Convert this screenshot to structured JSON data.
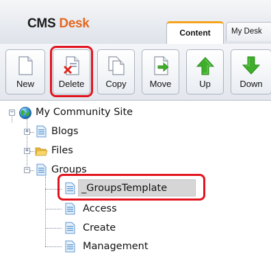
{
  "header": {
    "brand_part1": "CMS",
    "brand_part2": "Desk",
    "tabs": [
      {
        "label": "Content",
        "active": true
      },
      {
        "label": "My Desk",
        "active": false
      }
    ]
  },
  "toolbar": {
    "buttons": [
      {
        "label": "New",
        "icon": "new-document-icon",
        "highlighted": false
      },
      {
        "label": "Delete",
        "icon": "delete-document-icon",
        "highlighted": true
      },
      {
        "label": "Copy",
        "icon": "copy-document-icon",
        "highlighted": false
      },
      {
        "label": "Move",
        "icon": "move-document-icon",
        "highlighted": false
      },
      {
        "label": "Up",
        "icon": "arrow-up-icon",
        "highlighted": false
      },
      {
        "label": "Down",
        "icon": "arrow-down-icon",
        "highlighted": false
      }
    ]
  },
  "tree": {
    "root": {
      "label": "My Community Site",
      "icon": "globe-icon",
      "expanded": true
    },
    "children": [
      {
        "label": "Blogs",
        "icon": "page-icon",
        "expanded": false
      },
      {
        "label": "Files",
        "icon": "folder-icon",
        "expanded": false
      },
      {
        "label": "Groups",
        "icon": "page-icon",
        "expanded": true,
        "children": [
          {
            "label": "_GroupsTemplate",
            "icon": "page-icon",
            "selected": true
          },
          {
            "label": "Access",
            "icon": "page-icon"
          },
          {
            "label": "Create",
            "icon": "page-icon"
          },
          {
            "label": "Management",
            "icon": "page-icon"
          }
        ]
      }
    ]
  },
  "colors": {
    "accent_orange": "#e5671f",
    "tab_accent": "#f6a21a",
    "highlight_red": "#e3131d",
    "arrow_green": "#3fae2a",
    "page_blue": "#6aa9e0",
    "folder_yellow": "#f2c94c"
  }
}
